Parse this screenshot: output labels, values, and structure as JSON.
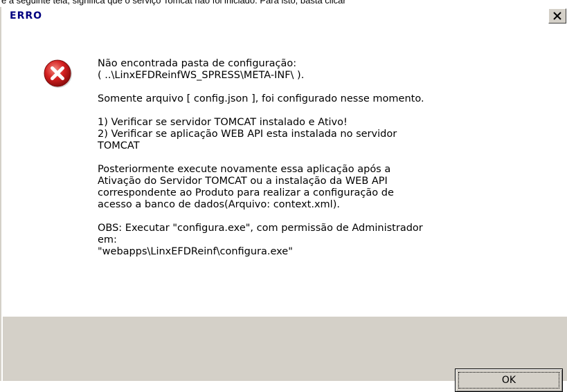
{
  "background_text": "e a seguinte tela, significa que o serviço Tomcat não foi iniciado. Para isto, basta clicar",
  "dialog": {
    "title": "ERRO",
    "close_glyph": "✕",
    "icon": "error-icon",
    "message_paragraphs": [
      "Não encontrada pasta de configuração:\n( ..\\LinxEFDReinfWS_SPRESS\\META-INF\\ ).",
      "Somente arquivo [ config.json ], foi configurado nesse momento.",
      "1) Verificar se servidor TOMCAT instalado e Ativo!\n2) Verificar se aplicação WEB API esta instalada no servidor\nTOMCAT",
      "Posteriormente execute novamente essa aplicação após a\nAtivação do Servidor TOMCAT ou a instalação da WEB API\ncorrespondente ao Produto para realizar a configuração de\nacesso a banco de dados(Arquivo: context.xml).",
      "OBS: Executar \"configura.exe\", com permissão de Administrador\nem:\n\"webapps\\LinxEFDReinf\\configura.exe\""
    ],
    "ok_label": "OK"
  },
  "colors": {
    "title_text": "#000080",
    "error_red": "#d42020",
    "panel_gray": "#d4d0c8"
  }
}
